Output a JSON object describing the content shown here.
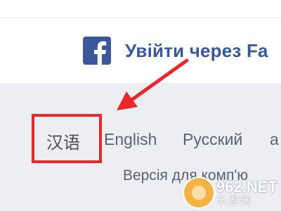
{
  "login": {
    "facebook_label": "Увійти через Fa"
  },
  "languages": {
    "items": [
      {
        "label": "汉语"
      },
      {
        "label": "English"
      },
      {
        "label": "Русский"
      },
      {
        "label": "a"
      }
    ],
    "desktop_link": "Версія для комп'ю"
  },
  "watermark": {
    "main": "962.NET",
    "sub": "乐游网"
  },
  "colors": {
    "facebook_blue": "#3b5998",
    "link_blue": "#385898",
    "annotation_red": "#e8282b",
    "footer_bg": "#eceef2"
  },
  "icons": {
    "facebook": "facebook-f-icon",
    "arrow": "red-arrow-annotation"
  }
}
